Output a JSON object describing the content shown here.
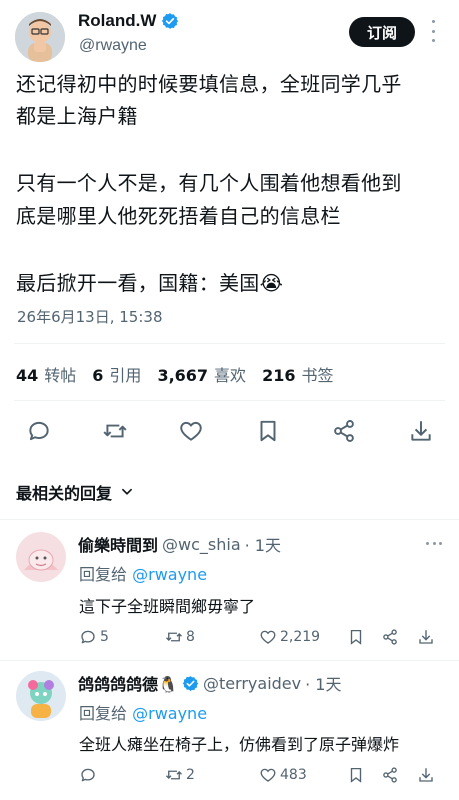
{
  "author": {
    "name": "Roland.W",
    "handle": "@rwayne"
  },
  "follow_label": "订阅",
  "tweet": {
    "lines": [
      "还记得初中的时候要填信息，全班同学几乎",
      "都是上海户籍",
      "只有一个人不是，有几个人围着他想看他到",
      "底是哪里人他死死捂着自己的信息栏",
      "最后掀开一看，国籍：美国😭"
    ],
    "timestamp": "26年6月13日, 15:38"
  },
  "stats": {
    "retweets": "44",
    "retweets_label": "转帖",
    "quotes": "6",
    "quotes_label": "引用",
    "likes": "3,667",
    "likes_label": "喜欢",
    "bookmarks": "216",
    "bookmarks_label": "书签"
  },
  "sort_label": "最相关的回复",
  "replies": [
    {
      "name": "偷樂時間到",
      "handle": "@wc_shia",
      "time": "· 1天",
      "replying_prefix": "回复给",
      "replying_to": "@rwayne",
      "text": "這下子全班瞬間鄉毋寧了",
      "replies": "5",
      "retweets": "8",
      "likes": "2,219"
    },
    {
      "name": "鸽鸽鸽鸽德🐧",
      "handle": "@terryaidev",
      "time": "· 1天",
      "replying_prefix": "回复给",
      "replying_to": "@rwayne",
      "text": "全班人瘫坐在椅子上，仿佛看到了原子弹爆炸",
      "replies": "",
      "retweets": "2",
      "likes": "483"
    }
  ],
  "colors": {
    "text": "#0f1419",
    "secondary": "#536471",
    "link": "#1d9bf0",
    "verified": "#1d9bf0",
    "divider": "#eff3f4"
  }
}
